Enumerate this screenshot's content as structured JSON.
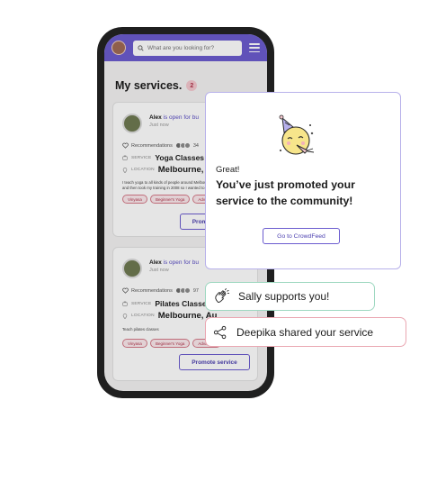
{
  "search": {
    "placeholder": "What are you looking for?"
  },
  "page": {
    "title": "My services.",
    "count": "2"
  },
  "cards": [
    {
      "user_name": "Alex",
      "user_status": "is open for bu",
      "posted": "Just now",
      "recommendations_label": "Recommendations",
      "recommendations_count": "34",
      "service_label": "SERVICE",
      "service": "Yoga Classes",
      "location_label": "LOCATION",
      "location": "Melbourne, Au",
      "description_lines": [
        "I teach yoga to all kinds of people around Melbourne",
        "and then took my training in 2008 so I wanted to help"
      ],
      "tags": [
        "Vinyasa",
        "Beginner's Yoga",
        "Advanced"
      ],
      "button": "Promote service"
    },
    {
      "user_name": "Alex",
      "user_status": "is open for bu",
      "posted": "Just now",
      "recommendations_label": "Recommendations",
      "recommendations_count": "97",
      "service_label": "SERVICE",
      "service": "Pilates Classe",
      "location_label": "LOCATION",
      "location": "Melbourne, Au",
      "description_lines": [
        "Teach pilates classes"
      ],
      "tags": [
        "Vinyasa",
        "Beginner's Yoga",
        "Advanced"
      ],
      "button": "Promote service"
    }
  ],
  "modal": {
    "greeting": "Great!",
    "headline": "You’ve just promoted your service to the community!",
    "cta": "Go to CrowdFeed"
  },
  "toasts": [
    {
      "icon": "clapping-hands-icon",
      "text": "Sally supports you!",
      "border_color": "#9fd8c1"
    },
    {
      "icon": "share-icon",
      "text": "Deepika shared your service",
      "border_color": "#eaa7b2"
    }
  ],
  "colors": {
    "brand": "#6b5ccf",
    "tag": "#b0344b",
    "badge_bg": "#f4c8cf"
  }
}
